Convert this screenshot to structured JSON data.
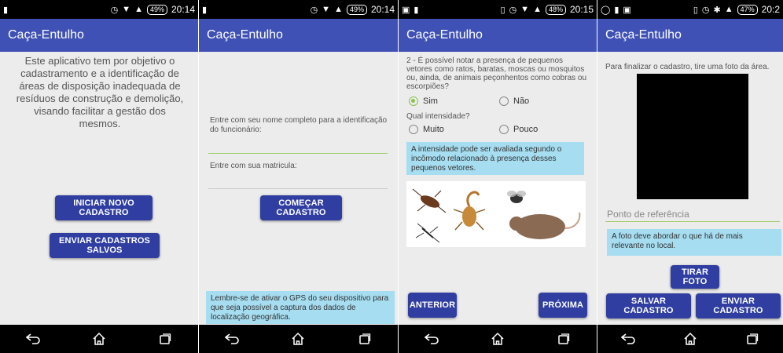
{
  "app": {
    "title": "Caça-Entulho"
  },
  "colors": {
    "appbar": "#3f51b5",
    "button": "#2f3ea0",
    "info_box": "#a6ddf0",
    "accent": "#8bc34a"
  },
  "screens": [
    {
      "status": {
        "time": "20:14",
        "battery": "49%"
      },
      "intro_text": "Este aplicativo tem por objetivo o cadastramento e a identificação de áreas de disposição inadequada de resíduos de construção e demolição, visando facilitar a gestão dos mesmos.",
      "btn_new": "INICIAR NOVO CADASTRO",
      "btn_send_saved": "ENVIAR CADASTROS SALVOS"
    },
    {
      "status": {
        "time": "20:14",
        "battery": "49%"
      },
      "name_label": "Entre com seu nome completo para a identificação do funcionário:",
      "reg_label": "Entre com sua matricula:",
      "btn_start": "COMEÇAR CADASTRO",
      "gps_note": "Lembre-se de ativar o GPS do seu dispositivo para que seja possível a captura dos dados de localização geográfica."
    },
    {
      "status": {
        "time": "20:15",
        "battery": "48%"
      },
      "question": "2 - É possível notar a presença de pequenos vetores como ratos, baratas, moscas ou mosquitos ou, ainda, de animais peçonhentos como cobras ou escorpiões?",
      "opt_yes": "Sim",
      "opt_no": "Não",
      "intensity_label": "Qual intensidade?",
      "opt_much": "Muito",
      "opt_little": "Pouco",
      "intensity_note": "A intensidade pode ser avaliada segundo o incômodo relacionado à presença desses pequenos vetores.",
      "btn_prev": "ANTERIOR",
      "btn_next": "PRÓXIMA"
    },
    {
      "status": {
        "time": "20:2",
        "battery": "47%"
      },
      "photo_instruction": "Para finalizar o cadastro, tire uma foto da área.",
      "ref_placeholder": "Ponto de referência",
      "photo_note": "A foto deve abordar o que há de mais relevante no local.",
      "btn_photo": "TIRAR FOTO",
      "btn_save": "SALVAR CADASTRO",
      "btn_send": "ENVIAR CADASTRO"
    }
  ]
}
